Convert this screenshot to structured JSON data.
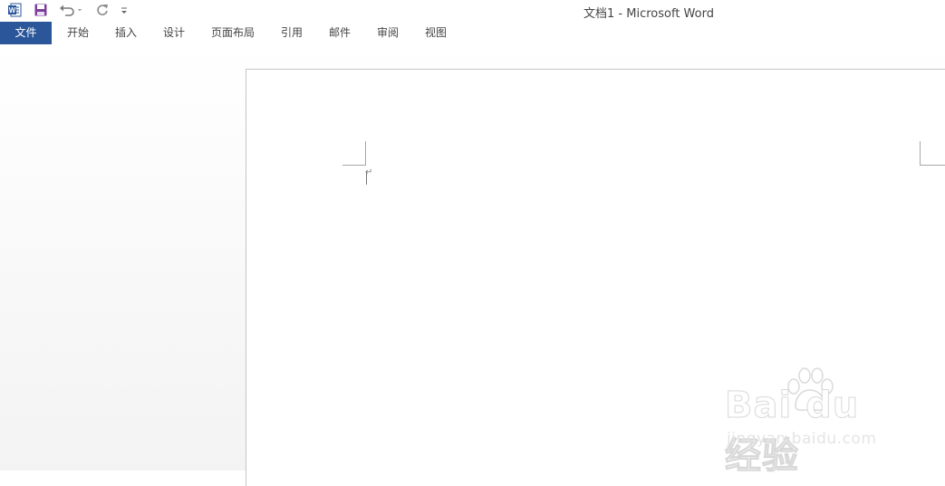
{
  "window": {
    "title": "文档1 - Microsoft Word"
  },
  "quick_access": {
    "icons": [
      "word-logo-icon",
      "save-icon",
      "undo-icon",
      "redo-icon",
      "customize-dropdown-icon"
    ]
  },
  "ribbon": {
    "tabs": [
      {
        "label": "文件",
        "active": true
      },
      {
        "label": "开始"
      },
      {
        "label": "插入"
      },
      {
        "label": "设计"
      },
      {
        "label": "页面布局"
      },
      {
        "label": "引用"
      },
      {
        "label": "邮件"
      },
      {
        "label": "审阅"
      },
      {
        "label": "视图"
      }
    ]
  },
  "document": {
    "paragraph_mark": "↵"
  },
  "watermark": {
    "brand": "Bai du 经验",
    "url": "jingyan.baidu.com"
  },
  "colors": {
    "accent": "#2b579a",
    "word_blue": "#2b579a",
    "save_purple": "#7b3f98"
  }
}
